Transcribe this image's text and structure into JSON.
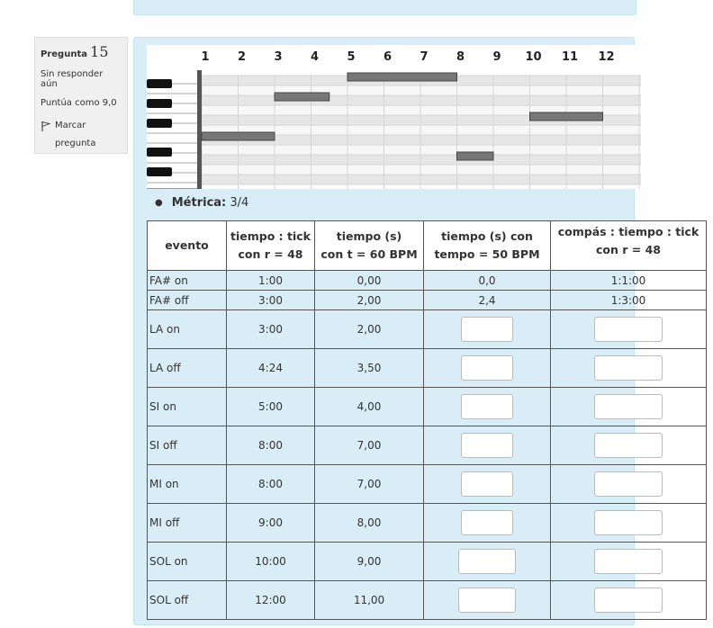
{
  "question": {
    "label": "Pregunta",
    "number": "15",
    "status": "Sin responder aún",
    "score": "Puntúa como 9,0",
    "flag_label": "Marcar pregunta"
  },
  "piano_roll": {
    "beats": [
      "1",
      "2",
      "3",
      "4",
      "5",
      "6",
      "7",
      "8",
      "9",
      "10",
      "11",
      "12"
    ],
    "notes": [
      {
        "name": "FA#",
        "start": 1,
        "end": 3
      },
      {
        "name": "LA",
        "start": 3,
        "end": 4.5
      },
      {
        "name": "SI",
        "start": 5,
        "end": 8
      },
      {
        "name": "MI",
        "start": 8,
        "end": 9
      },
      {
        "name": "SOL",
        "start": 10,
        "end": 12
      }
    ]
  },
  "metric": {
    "label": "Métrica:",
    "value": "3/4"
  },
  "table": {
    "headers": [
      [
        "evento"
      ],
      [
        "tiempo : tick",
        "con r = 48"
      ],
      [
        "tiempo (s)",
        "con t = 60 BPM"
      ],
      [
        "tiempo (s) con",
        "tempo = 50 BPM"
      ],
      [
        "compás : tiempo : tick",
        "con r = 48"
      ]
    ],
    "rows": [
      {
        "event": "FA# on",
        "tick": "1:00",
        "sec60": "0,00",
        "sec50": "0,0",
        "bar": "1:1:00"
      },
      {
        "event": "FA# off",
        "tick": "3:00",
        "sec60": "2,00",
        "sec50": "2,4",
        "bar": "1:3:00"
      },
      {
        "event": "LA on",
        "tick": "3:00",
        "sec60": "2,00",
        "sec50": "",
        "bar": ""
      },
      {
        "event": "LA off",
        "tick": "4:24",
        "sec60": "3,50",
        "sec50": "",
        "bar": ""
      },
      {
        "event": "SI on",
        "tick": "5:00",
        "sec60": "4,00",
        "sec50": "",
        "bar": ""
      },
      {
        "event": "SI off",
        "tick": "8:00",
        "sec60": "7,00",
        "sec50": "",
        "bar": ""
      },
      {
        "event": "MI on",
        "tick": "8:00",
        "sec60": "7,00",
        "sec50": "",
        "bar": ""
      },
      {
        "event": "MI off",
        "tick": "9:00",
        "sec60": "8,00",
        "sec50": "",
        "bar": ""
      },
      {
        "event": "SOL on",
        "tick": "10:00",
        "sec60": "9,00",
        "sec50": "",
        "bar": ""
      },
      {
        "event": "SOL off",
        "tick": "12:00",
        "sec60": "11,00",
        "sec50": "",
        "bar": ""
      }
    ]
  }
}
